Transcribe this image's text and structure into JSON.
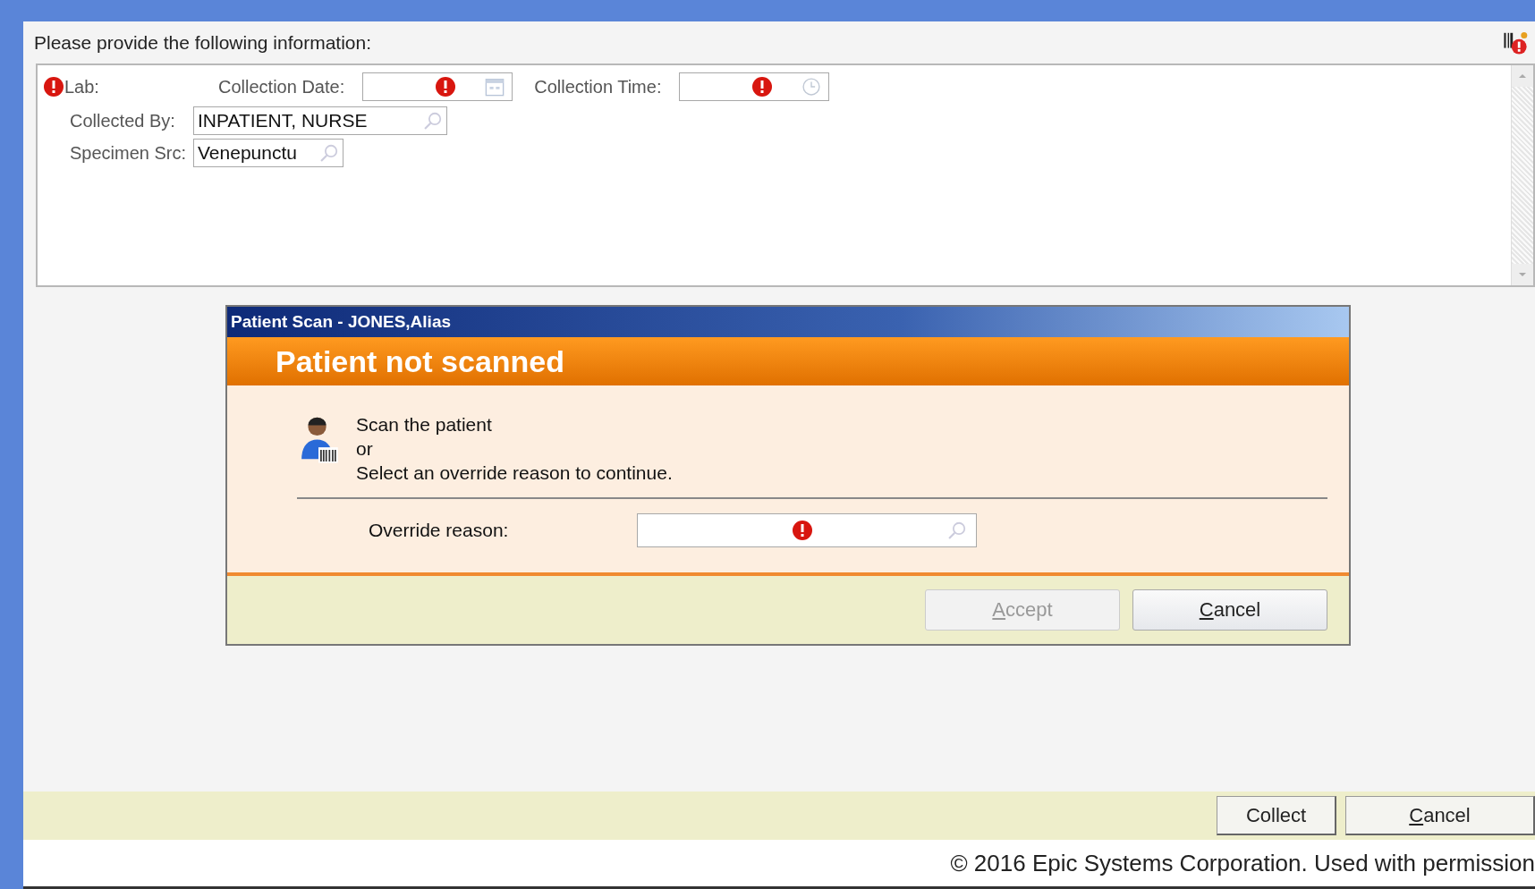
{
  "heading": "Please provide the following information:",
  "form": {
    "fields": [
      {
        "kind": "label",
        "label": "Lab:",
        "required": true
      },
      {
        "kind": "date",
        "label": "Collection Date:",
        "required": true
      },
      {
        "kind": "time",
        "label": "Collection Time:",
        "required": true
      }
    ],
    "rows": [
      {
        "label": "Collected By:",
        "value": "INPATIENT, NURSE"
      },
      {
        "label": "Specimen Src:",
        "value": "Venepunctu"
      }
    ]
  },
  "dialog": {
    "title": "Patient Scan - JONES,Alias",
    "banner": "Patient not scanned",
    "lines": [
      "Scan the patient",
      "or",
      "Select an override reason to continue."
    ],
    "override": {
      "label": "Override reason:",
      "required": true
    },
    "buttons": [
      {
        "label": "Accept",
        "disabled": true,
        "mnemonic": true
      },
      {
        "label": "Cancel",
        "disabled": false,
        "mnemonic": true
      }
    ]
  },
  "footer_buttons": [
    {
      "label": "Collect",
      "mnemonic": false
    },
    {
      "label": "Cancel",
      "mnemonic": true
    }
  ],
  "copyright": "© 2016 Epic Systems Corporation. Used with permission"
}
